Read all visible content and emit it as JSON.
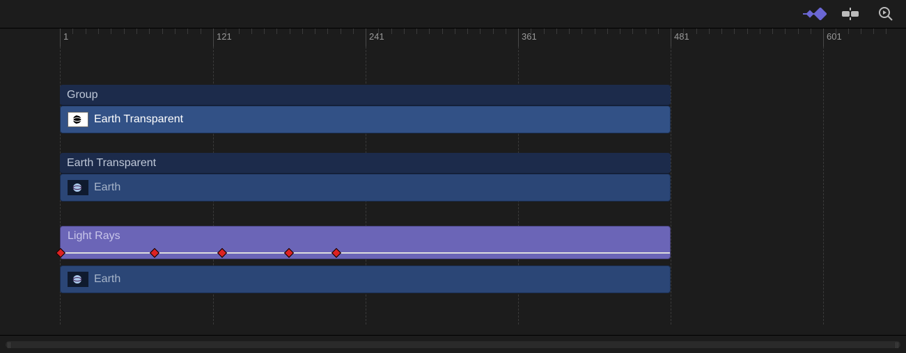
{
  "toolbar": {
    "keyframe_tool": "keyframe",
    "timeline_tool": "timeline-view",
    "preview_tool": "preview"
  },
  "ruler": {
    "labels": [
      "1",
      "121",
      "241",
      "361",
      "481",
      "601"
    ]
  },
  "tracks": {
    "group1": {
      "header": "Group",
      "clip": "Earth Transparent"
    },
    "group2": {
      "header": "Earth Transparent",
      "clip": "Earth"
    },
    "filter": {
      "name": "Light Rays"
    },
    "group3": {
      "clip": "Earth"
    }
  }
}
